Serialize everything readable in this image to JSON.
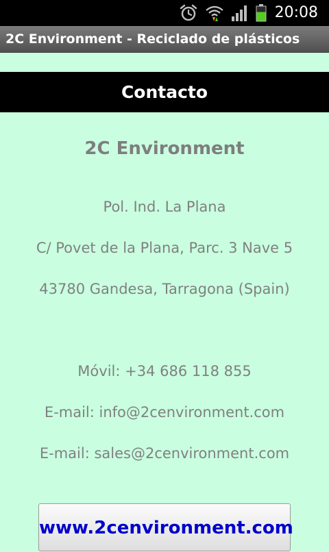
{
  "status_bar": {
    "time": "20:08",
    "icons": [
      "alarm-clock-icon",
      "wifi-icon",
      "signal-bars-icon",
      "battery-icon"
    ],
    "battery_color": "#55cc22"
  },
  "app": {
    "title": "2C Environment - Reciclado de plásticos"
  },
  "header": {
    "title": "Contacto"
  },
  "contact": {
    "company": "2C Environment",
    "address_line_1": "Pol. Ind. La Plana",
    "address_line_2": "C/ Povet de la Plana, Parc. 3 Nave 5",
    "address_line_3": "43780 Gandesa, Tarragona (Spain)",
    "mobile": "Móvil: +34 686 118 855",
    "email_1": "E-mail: info@2cenvironment.com",
    "email_2": "E-mail: sales@2cenvironment.com"
  },
  "website_button": {
    "label": "www.2cenvironment.com"
  },
  "colors": {
    "background": "#c9ffe0",
    "text_gray": "#808080",
    "link_blue": "#0000cc"
  }
}
